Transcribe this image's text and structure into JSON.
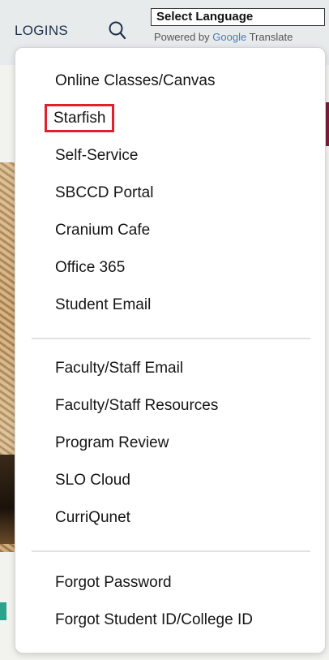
{
  "header": {
    "logins_label": "LOGINS",
    "language_select_value": "Select Language",
    "powered_prefix": "Powered by",
    "powered_brand": "Google",
    "powered_suffix": "Translate"
  },
  "icons": {
    "search": "search-icon"
  },
  "colors": {
    "highlight_border": "#e0202a",
    "header_background": "#e7ebec",
    "menu_text": "#151515"
  },
  "menu": {
    "group1": [
      {
        "label": "Online Classes/Canvas"
      },
      {
        "label": "Starfish",
        "highlighted": true
      },
      {
        "label": "Self-Service"
      },
      {
        "label": "SBCCD Portal"
      },
      {
        "label": "Cranium Cafe"
      },
      {
        "label": "Office 365"
      },
      {
        "label": "Student Email"
      }
    ],
    "group2": [
      {
        "label": "Faculty/Staff Email"
      },
      {
        "label": "Faculty/Staff Resources"
      },
      {
        "label": "Program Review"
      },
      {
        "label": "SLO Cloud"
      },
      {
        "label": "CurriQunet"
      }
    ],
    "group3": [
      {
        "label": "Forgot Password"
      },
      {
        "label": "Forgot Student ID/College ID"
      }
    ]
  }
}
